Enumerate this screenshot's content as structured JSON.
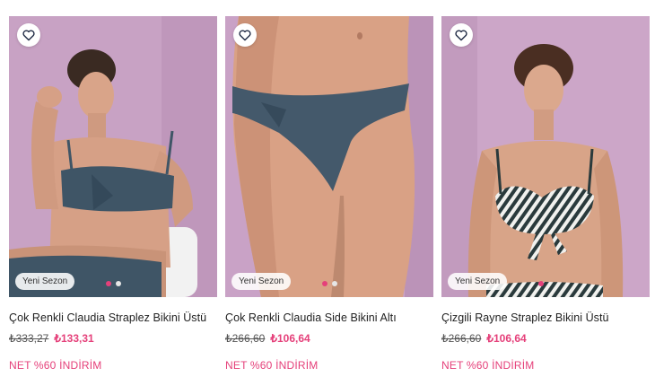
{
  "colors": {
    "accent": "#e5407a",
    "background": "#ffffff",
    "photo_wall": "#c9a3c6"
  },
  "icons": {
    "favorite": "heart-outline-icon"
  },
  "products": [
    {
      "badge": "Yeni Sezon",
      "title": "Çok Renkli Claudia Straplez Bikini Üstü",
      "old_price": "₺333,27",
      "new_price": "₺133,31",
      "discount": "NET %60 İNDİRİM",
      "carousel": {
        "count": 2,
        "active": 1
      }
    },
    {
      "badge": "Yeni Sezon",
      "title": "Çok Renkli Claudia Side Bikini Altı",
      "old_price": "₺266,60",
      "new_price": "₺106,64",
      "discount": "NET %60 İNDİRİM",
      "carousel": {
        "count": 2,
        "active": 1
      }
    },
    {
      "badge": "Yeni Sezon",
      "title": "Çizgili Rayne Straplez Bikini Üstü",
      "old_price": "₺266,60",
      "new_price": "₺106,64",
      "discount": "NET %60 İNDİRİM",
      "carousel": {
        "count": 1,
        "active": 1
      }
    }
  ]
}
